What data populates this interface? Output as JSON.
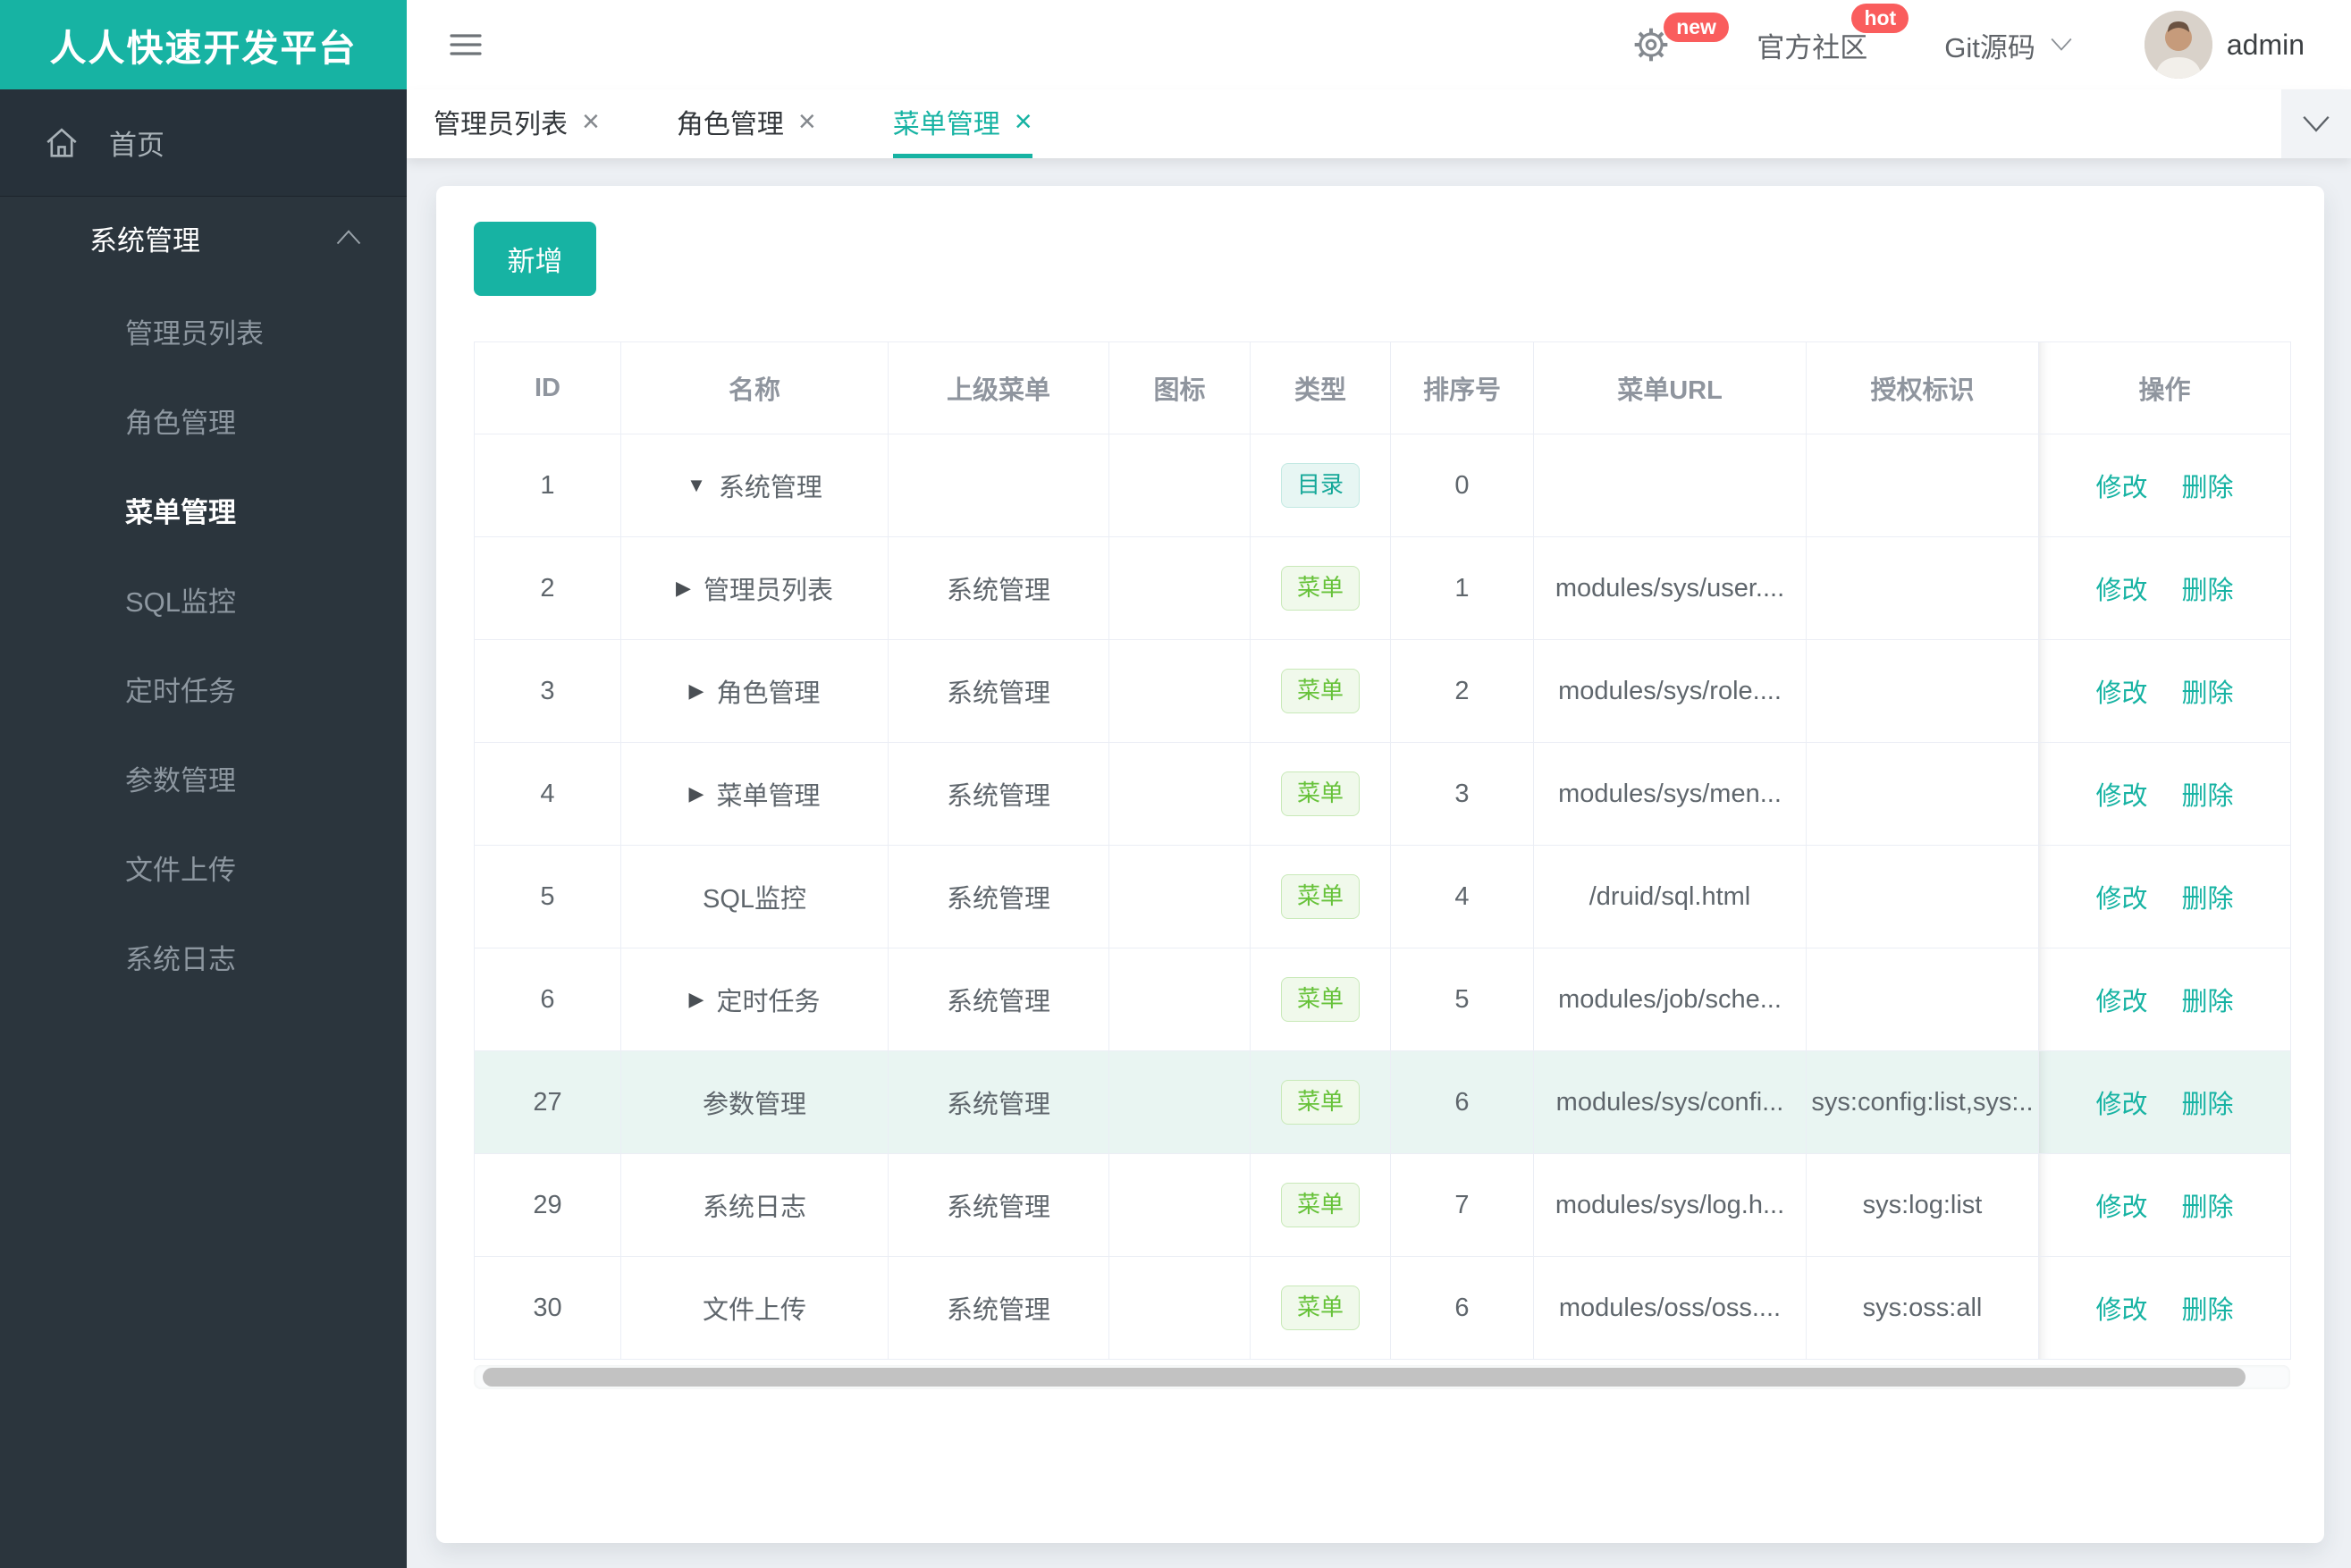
{
  "app": {
    "logo_title": "人人快速开发平台"
  },
  "sidebar": {
    "home_label": "首页",
    "group_title": "系统管理",
    "items": [
      "管理员列表",
      "角色管理",
      "菜单管理",
      "SQL监控",
      "定时任务",
      "参数管理",
      "文件上传",
      "系统日志"
    ],
    "active_item": "菜单管理"
  },
  "topbar": {
    "badge_new": "new",
    "badge_hot": "hot",
    "community_label": "官方社区",
    "git_label": "Git源码",
    "username": "admin"
  },
  "tabs": {
    "items": [
      "管理员列表",
      "角色管理",
      "菜单管理"
    ],
    "active": "菜单管理",
    "close_glyph": "×"
  },
  "toolbar": {
    "add_button": "新增"
  },
  "table": {
    "columns": [
      "ID",
      "名称",
      "上级菜单",
      "图标",
      "类型",
      "排序号",
      "菜单URL",
      "授权标识",
      "操作"
    ],
    "action_edit": "修改",
    "action_delete": "删除",
    "type_styles": {
      "目录": "dir",
      "菜单": "menu"
    },
    "expander_glyphs": {
      "expanded": "▼",
      "collapsed": "▶"
    },
    "rows": [
      {
        "id": 1,
        "name": "系统管理",
        "expander": "expanded",
        "parent": "",
        "icon": "",
        "type": "目录",
        "order": 0,
        "url": "",
        "perms": "",
        "highlighted": false
      },
      {
        "id": 2,
        "name": "管理员列表",
        "expander": "collapsed",
        "parent": "系统管理",
        "icon": "",
        "type": "菜单",
        "order": 1,
        "url": "modules/sys/user....",
        "perms": "",
        "highlighted": false
      },
      {
        "id": 3,
        "name": "角色管理",
        "expander": "collapsed",
        "parent": "系统管理",
        "icon": "",
        "type": "菜单",
        "order": 2,
        "url": "modules/sys/role....",
        "perms": "",
        "highlighted": false
      },
      {
        "id": 4,
        "name": "菜单管理",
        "expander": "collapsed",
        "parent": "系统管理",
        "icon": "",
        "type": "菜单",
        "order": 3,
        "url": "modules/sys/men...",
        "perms": "",
        "highlighted": false
      },
      {
        "id": 5,
        "name": "SQL监控",
        "expander": "none",
        "parent": "系统管理",
        "icon": "",
        "type": "菜单",
        "order": 4,
        "url": "/druid/sql.html",
        "perms": "",
        "highlighted": false
      },
      {
        "id": 6,
        "name": "定时任务",
        "expander": "collapsed",
        "parent": "系统管理",
        "icon": "",
        "type": "菜单",
        "order": 5,
        "url": "modules/job/sche...",
        "perms": "",
        "highlighted": false
      },
      {
        "id": 27,
        "name": "参数管理",
        "expander": "none",
        "parent": "系统管理",
        "icon": "",
        "type": "菜单",
        "order": 6,
        "url": "modules/sys/confi...",
        "perms": "sys:config:list,sys:..",
        "highlighted": true
      },
      {
        "id": 29,
        "name": "系统日志",
        "expander": "none",
        "parent": "系统管理",
        "icon": "",
        "type": "菜单",
        "order": 7,
        "url": "modules/sys/log.h...",
        "perms": "sys:log:list",
        "highlighted": false
      },
      {
        "id": 30,
        "name": "文件上传",
        "expander": "none",
        "parent": "系统管理",
        "icon": "",
        "type": "菜单",
        "order": 6,
        "url": "modules/oss/oss....",
        "perms": "sys:oss:all",
        "highlighted": false
      }
    ]
  },
  "colors": {
    "accent": "#17b3a3",
    "badge_red": "#fa5d5d",
    "tag_dir_text": "#16a899",
    "tag_menu_text": "#67c23a",
    "row_highlight": "#e9f5f2",
    "sidebar_bg": "#2b353d"
  }
}
